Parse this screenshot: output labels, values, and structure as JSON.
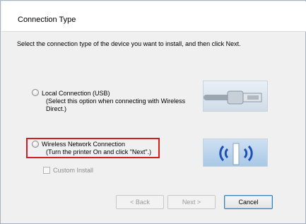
{
  "window": {
    "title": "Connection Type"
  },
  "instruction": "Select the connection type of the device you want to install, and then click Next.",
  "options": {
    "local": {
      "label": "Local Connection (USB)",
      "desc1": "(Select this option when connecting with Wireless",
      "desc2": "Direct.)"
    },
    "wireless": {
      "label": "Wireless Network Connection",
      "desc": "(Turn the printer On and click \"Next\".)"
    }
  },
  "custom_install": {
    "label": "Custom Install"
  },
  "buttons": {
    "back": "< Back",
    "next": "Next >",
    "cancel": "Cancel"
  },
  "colors": {
    "highlight": "#d11f1f",
    "header_bg": "#ffffff",
    "body_bg": "#f0f0f0"
  },
  "icons": {
    "usb": "usb-cable-icon",
    "wireless": "wireless-signal-icon"
  }
}
